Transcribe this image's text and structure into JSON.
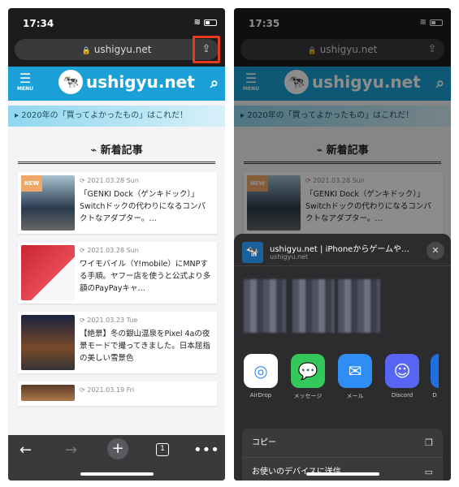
{
  "left": {
    "time": "17:34",
    "url": "ushigyu.net",
    "site_name": "ushigyu.net",
    "menu_label": "MENU",
    "banner": "2020年の「買ってよかったもの」はこれだ！",
    "section_title": "新着記事",
    "articles": [
      {
        "badge": "NEW",
        "date": "2021.03.28 Sun",
        "title": "「GENKI Dock（ゲンキドック）」Switchドックの代わりになるコンパクトなアダプター。…"
      },
      {
        "date": "2021.03.28 Sun",
        "title": "ワイモバイル（Y!mobile）にMNPする手順。ヤフー店を使うと公式より多額のPayPayキャ…"
      },
      {
        "date": "2021.03.23 Tue",
        "title": "【絶景】冬の銀山温泉をPixel 4aの夜景モードで撮ってきました。日本屈指の美しい雪景色"
      },
      {
        "date": "2021.03.19 Fri",
        "title": ""
      }
    ],
    "tab_count": "1"
  },
  "right": {
    "time": "17:35",
    "url": "ushigyu.net",
    "site_name": "ushigyu.net",
    "menu_label": "MENU",
    "banner": "2020年の「買ってよかったもの」はこれだ！",
    "section_title": "新着記事",
    "articles": [
      {
        "badge": "NEW",
        "date": "2021.03.28 Sun",
        "title": "「GENKI Dock（ゲンキドック）」Switchドックの代わりになるコンパクトなアダプター。…"
      }
    ],
    "share_sheet": {
      "title": "ushigyu.net | iPhoneからゲームや…",
      "url": "ushigyu.net",
      "apps": [
        {
          "label": "AirDrop",
          "color": "#ffffff"
        },
        {
          "label": "メッセージ",
          "color": "#34c759"
        },
        {
          "label": "メール",
          "color": "#2f8ef5"
        },
        {
          "label": "Discord",
          "color": "#5865f2"
        },
        {
          "label": "D",
          "color": "#1f6fe0"
        }
      ],
      "actions": [
        {
          "label": "コピー"
        },
        {
          "label": "お使いのデバイスに送信"
        }
      ]
    }
  }
}
